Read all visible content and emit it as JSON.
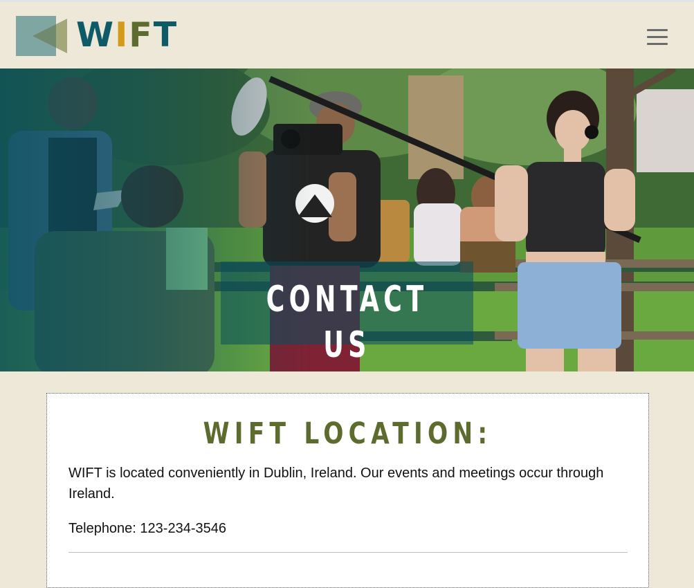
{
  "header": {
    "logo_text": "WIFT",
    "logo_colors": [
      "#0e5a67",
      "#d49a1a",
      "#5d6b2f",
      "#0e5a67"
    ],
    "menu_icon": "hamburger-icon"
  },
  "hero": {
    "title": "CONTACT US",
    "overlay_color": "#084e5c"
  },
  "location": {
    "title": "WIFT LOCATION:",
    "paragraph": "WIFT is located conveniently in Dublin, Ireland. Our events and meetings occur through Ireland.",
    "telephone": "Telephone: 123-234-3546"
  },
  "colors": {
    "background": "#ede8d8",
    "heading": "#5d6b2f",
    "teal": "#0e5a67",
    "gold": "#d49a1a"
  }
}
